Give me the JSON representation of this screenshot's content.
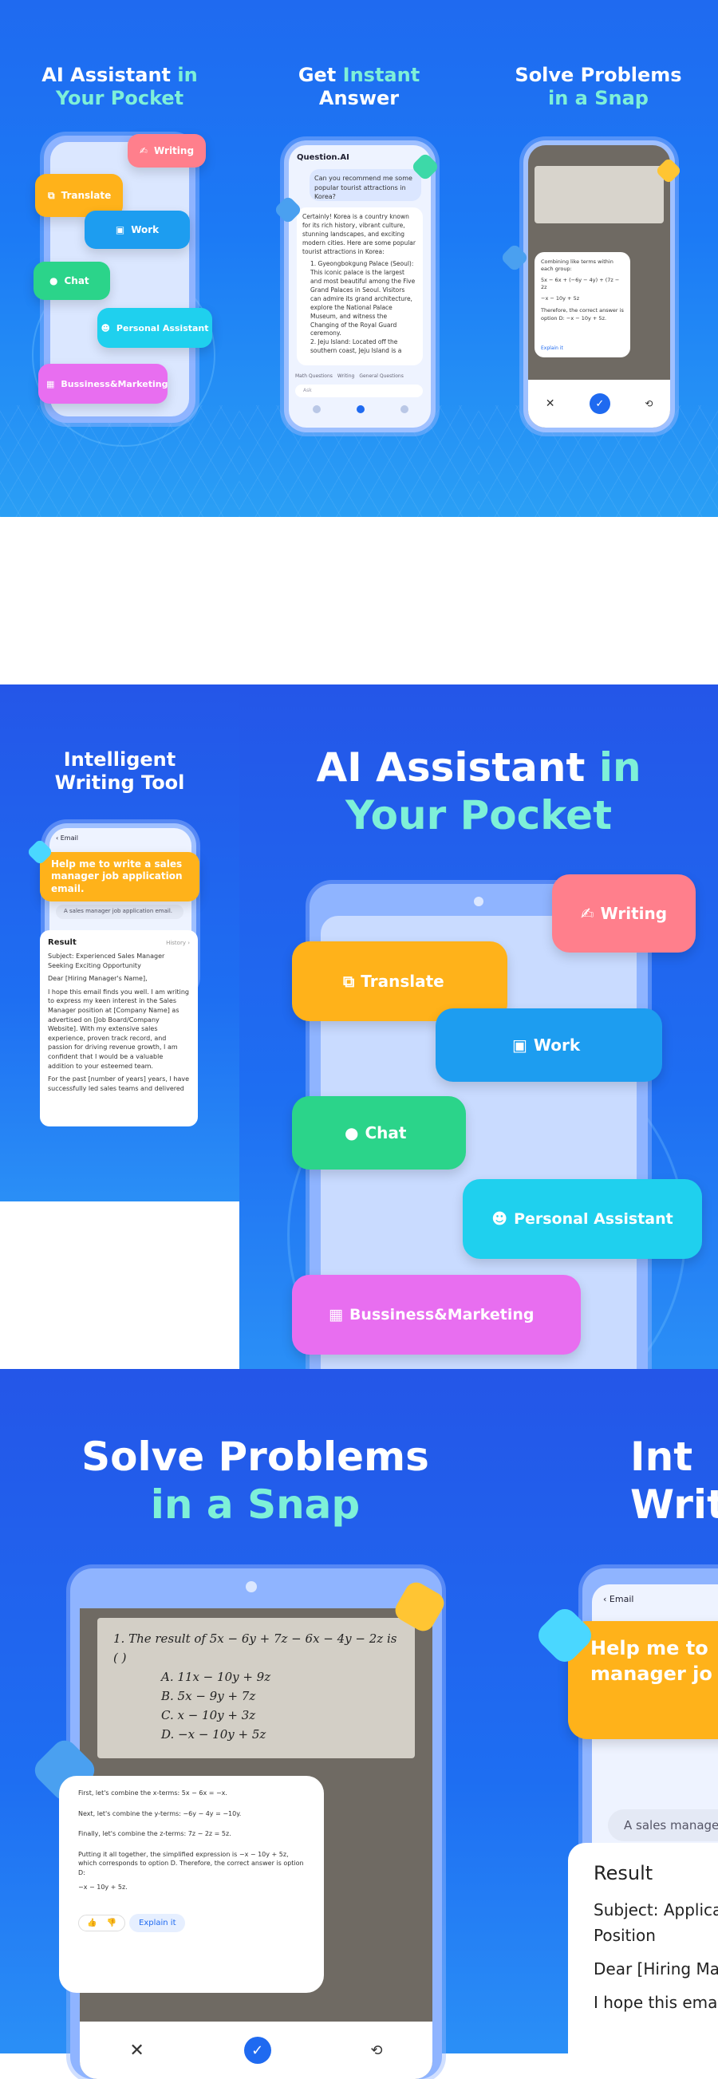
{
  "panel1": {
    "title_a": "AI Assistant ",
    "title_hl": "in",
    "title_b": "Your Pocket",
    "pills": [
      "Writing",
      "Translate",
      "Work",
      "Chat",
      "Personal Assistant",
      "Bussiness&Marketing"
    ]
  },
  "panel2": {
    "title_a": "Get ",
    "title_hl": "Instant",
    "title_b": "Answer",
    "app_name": "Question.AI",
    "question": "Can you recommend me some popular tourist attractions in Korea?",
    "answer_intro": "Certainly! Korea is a country known for its rich history, vibrant culture, stunning landscapes, and exciting modern cities. Here are some popular tourist attractions in Korea:",
    "item1": "Gyeongbokgung Palace (Seoul): This iconic palace is the largest and most beautiful among the Five Grand Palaces in Seoul. Visitors can admire its grand architecture, explore the National Palace Museum, and witness the Changing of the Royal Guard ceremony.",
    "item2": "Jeju Island: Located off the southern coast, Jeju Island is a",
    "tabs": [
      "Math Questions",
      "Writing",
      "General Questions"
    ],
    "input_placeholder": "Ask"
  },
  "panel3": {
    "title_a": "Solve Problems",
    "title_hl": "in a Snap",
    "snip_line1": "Combining like terms within each group:",
    "snip_eq1": "5x − 6x + (−6y − 4y) + (7z − 2z",
    "snip_eq2": "−x − 10y + 5z",
    "snip_ans": "Therefore, the correct answer is option D: −x − 10y + 5z.",
    "explain": "Explain it"
  },
  "panel4": {
    "title_a": "Intelligent",
    "title_b": "Writing Tool",
    "email_back": "Email",
    "prompt": "Help me to write a sales manager job application email.",
    "input_text": "A sales manager job application email.",
    "result_label": "Result",
    "history_label": "History",
    "subject": "Subject: Experienced Sales Manager Seeking Exciting Opportunity",
    "greeting": "Dear [Hiring Manager's Name],",
    "para1": "I hope this email finds you well. I am writing to express my keen interest in the Sales Manager position at [Company Name] as advertised on [Job Board/Company Website]. With my extensive sales experience, proven track record, and passion for driving revenue growth, I am confident that I would be a valuable addition to your esteemed team.",
    "para2": "For the past [number of years] years, I have successfully led sales teams and delivered"
  },
  "panel5": {
    "title_a": "AI Assistant ",
    "title_hl": "in",
    "title_b": "Your Pocket",
    "pills": [
      "Writing",
      "Translate",
      "Work",
      "Chat",
      "Personal Assistant",
      "Bussiness&Marketing"
    ]
  },
  "panel6": {
    "title_a": "Solve Problems",
    "title_hl": "in a Snap",
    "hw_line1": "1. The result of 5x − 6y + 7z − 6x − 4y − 2z is ( )",
    "hw_a": "A. 11x − 10y + 9z",
    "hw_b": "B. 5x − 9y + 7z",
    "hw_c": "C. x − 10y + 3z",
    "hw_d": "D. −x − 10y + 5z",
    "step1": "First, let's combine the x-terms: 5x − 6x = −x.",
    "step2": "Next, let's combine the y-terms: −6y − 4y = −10y.",
    "step3": "Finally, let's combine the z-terms: 7z − 2z = 5z.",
    "step4": "Putting it all together, the simplified expression is −x − 10y + 5z, which corresponds to option D. Therefore, the correct answer is option D:",
    "step5": "−x − 10y + 5z.",
    "explain": "Explain it"
  },
  "panel7": {
    "title_a": "Int",
    "title_b": "Writ",
    "email_back": "Email",
    "prompt_a": "Help me to",
    "prompt_b": "manager jo",
    "input_text": "A sales manager",
    "result_label": "Result",
    "subject_a": "Subject: Applicat",
    "subject_b": "Position",
    "greeting": "Dear [Hiring Mar",
    "para": "I hope this email"
  },
  "colors": {
    "blue": "#1f6af0",
    "mint": "#7ef0d8",
    "pink": "#ff7f8c",
    "orange": "#ffb21a",
    "work": "#1d9df0",
    "chat": "#2bd48a",
    "assistant": "#1fd0ee",
    "biz": "#e86ef0"
  }
}
